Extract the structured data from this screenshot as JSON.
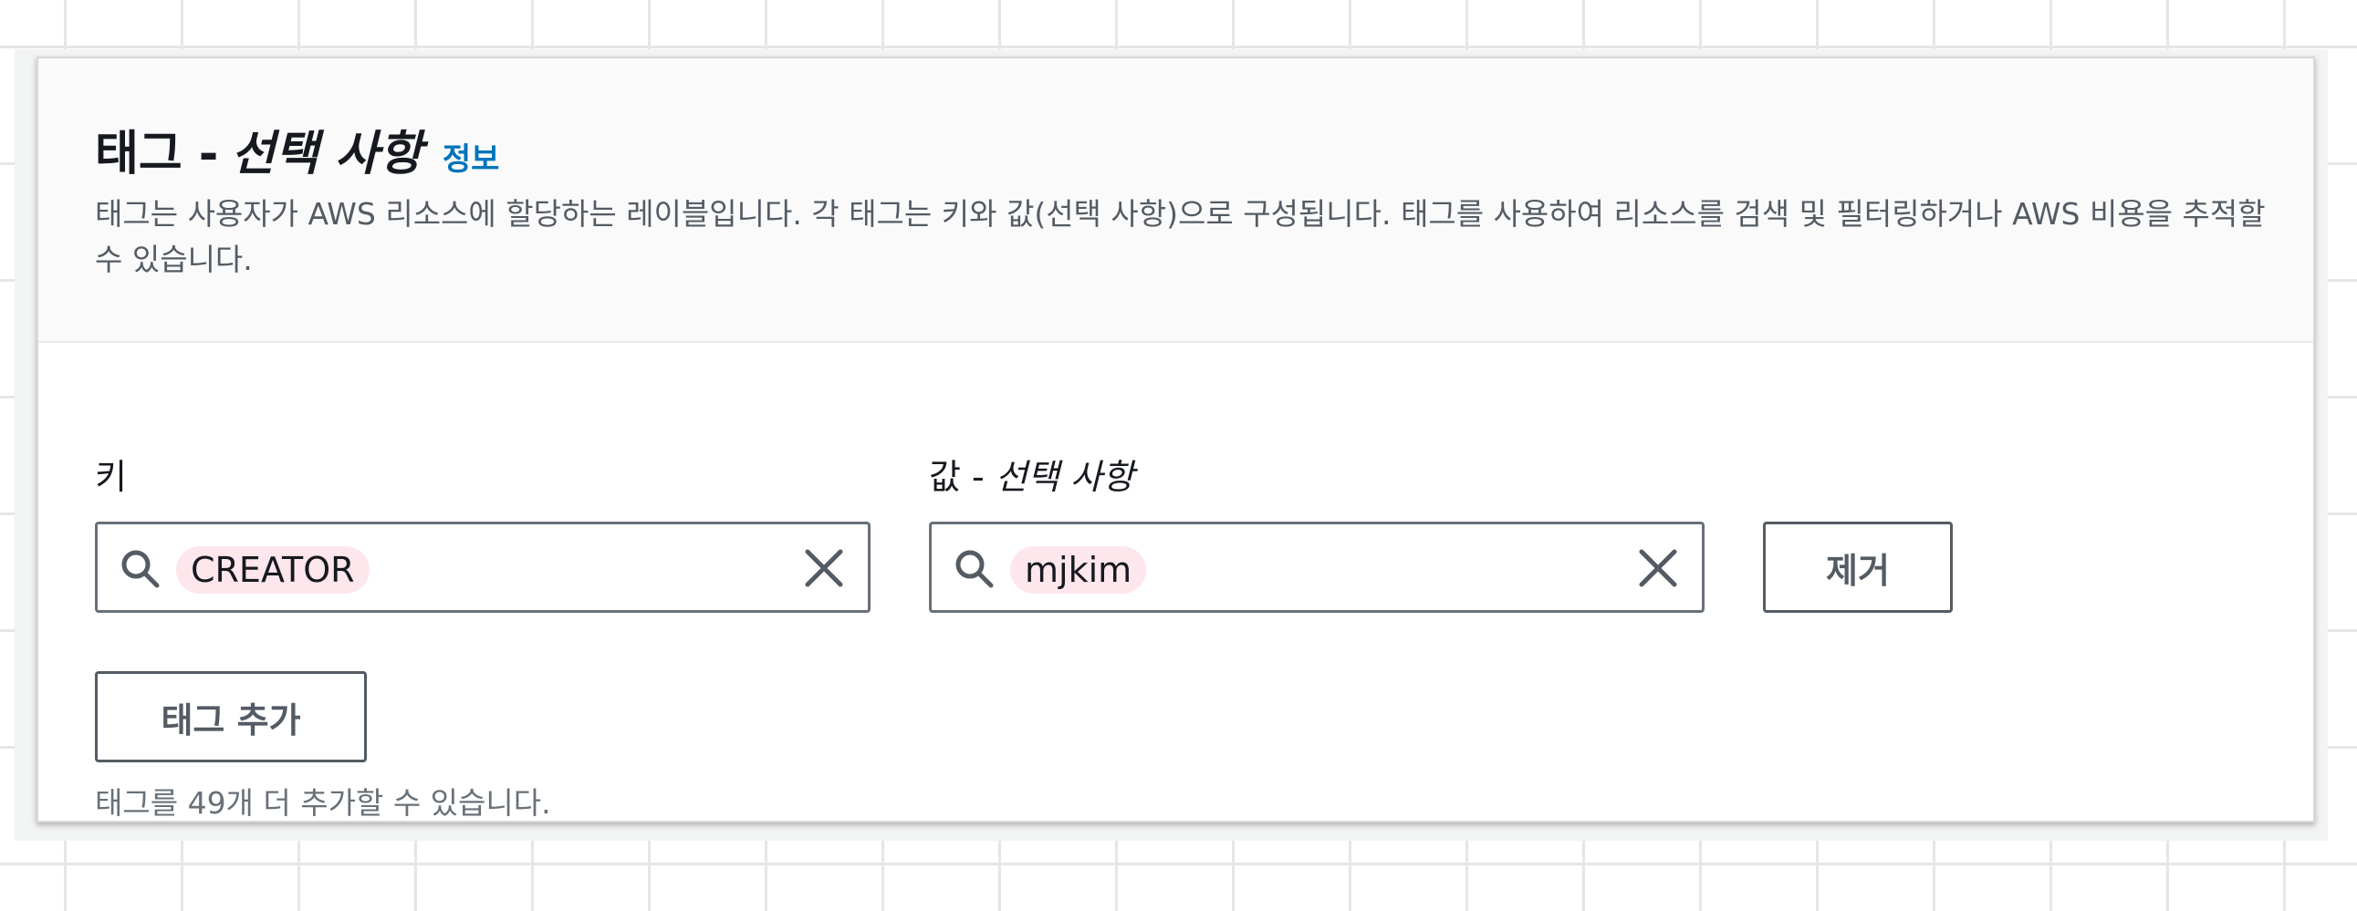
{
  "section": {
    "title": "태그 -",
    "title_optional": "선택 사항",
    "info_link": "정보",
    "description": "태그는 사용자가 AWS 리소스에 할당하는 레이블입니다. 각 태그는 키와 값(선택 사항)으로 구성됩니다. 태그를 사용하여 리소스를 검색 및 필터링하거나 AWS 비용을 추적할 수 있습니다."
  },
  "tag_row": {
    "key_label": "키",
    "key_value": "CREATOR",
    "value_label": "값 -",
    "value_label_optional": "선택 사항",
    "value_value": "mjkim",
    "remove_button": "제거"
  },
  "add_tag_button": "태그 추가",
  "remaining_hint": "태그를 49개 더 추가할 수 있습니다.",
  "icons": {
    "search": "search-icon",
    "clear": "close-icon"
  },
  "colors": {
    "info_link": "#0073bb",
    "token_background": "#fde6ec",
    "border": "#687078"
  }
}
